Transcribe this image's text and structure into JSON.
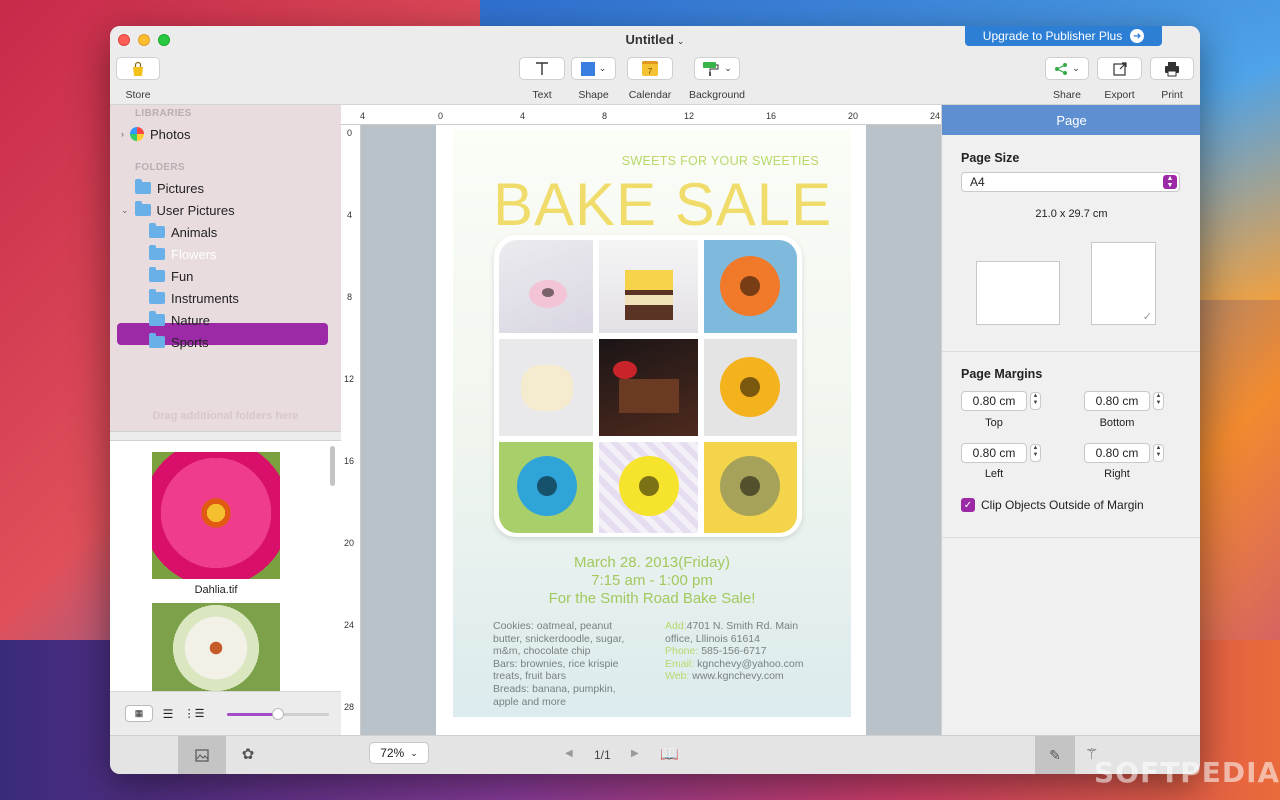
{
  "window": {
    "title": "Untitled",
    "upgrade_label": "Upgrade to Publisher Plus"
  },
  "toolbar": {
    "store": "Store",
    "text": "Text",
    "shape": "Shape",
    "calendar": "Calendar",
    "calendar_day": "7",
    "background": "Background",
    "share": "Share",
    "export": "Export",
    "print": "Print"
  },
  "sidebar": {
    "libraries_header": "LIBRARIES",
    "photos": "Photos",
    "folders_header": "FOLDERS",
    "pictures": "Pictures",
    "user_pictures": "User Pictures",
    "sub": [
      "Animals",
      "Flowers",
      "Fun",
      "Instruments",
      "Nature",
      "Sports"
    ],
    "drag_hint": "Drag additional folders here",
    "thumb1_name": "Dahlia.tif"
  },
  "ruler": {
    "top": [
      "4",
      "0",
      "4",
      "8",
      "12",
      "16",
      "20",
      "24"
    ],
    "left": [
      "0",
      "4",
      "8",
      "12",
      "16",
      "20",
      "24",
      "28"
    ]
  },
  "poster": {
    "tagline": "SWEETS FOR YOUR SWEETIES",
    "headline": "BAKE SALE",
    "date": "March 28. 2013(Friday)",
    "time": "7:15 am - 1:00 pm",
    "cta": "For the Smith Road Bake Sale!",
    "items_left": [
      "Cookies: oatmeal, peanut",
      "butter, snickerdoodle, sugar,",
      "m&m, chocolate chip",
      "Bars: brownies, rice krispie",
      "treats, fruit bars",
      "Breads:  banana, pumpkin,",
      "apple and more"
    ],
    "add_label": "Add:",
    "add_value": "4701 N. Smith Rd. Main",
    "add_value2": "office,  Lllinois 61614",
    "phone_label": "Phone:",
    "phone_value": " 585-156-6717",
    "email_label": "Email:",
    "email_value": " kgnchevy@yahoo.com",
    "web_label": "Web:",
    "web_value": " www.kgnchevy.com"
  },
  "inspector": {
    "tab": "Page",
    "page_size_label": "Page Size",
    "page_size_value": "A4",
    "dimensions": "21.0 x 29.7 cm",
    "margins_label": "Page Margins",
    "top_value": "0.80 cm",
    "top_label": "Top",
    "bottom_value": "0.80 cm",
    "bottom_label": "Bottom",
    "left_value": "0.80 cm",
    "left_label": "Left",
    "right_value": "0.80 cm",
    "right_label": "Right",
    "clip_label": "Clip Objects Outside of Margin",
    "clip_checked": true
  },
  "status": {
    "zoom": "72%",
    "page_indicator": "1/1"
  },
  "watermark": "SOFTPEDIA",
  "colors": {
    "accent": "#9c2aa6",
    "headline": "#f0dc6a",
    "tagline": "#b8d86a",
    "info_green": "#a3c85e",
    "inspector_head": "#5d8fd1"
  }
}
